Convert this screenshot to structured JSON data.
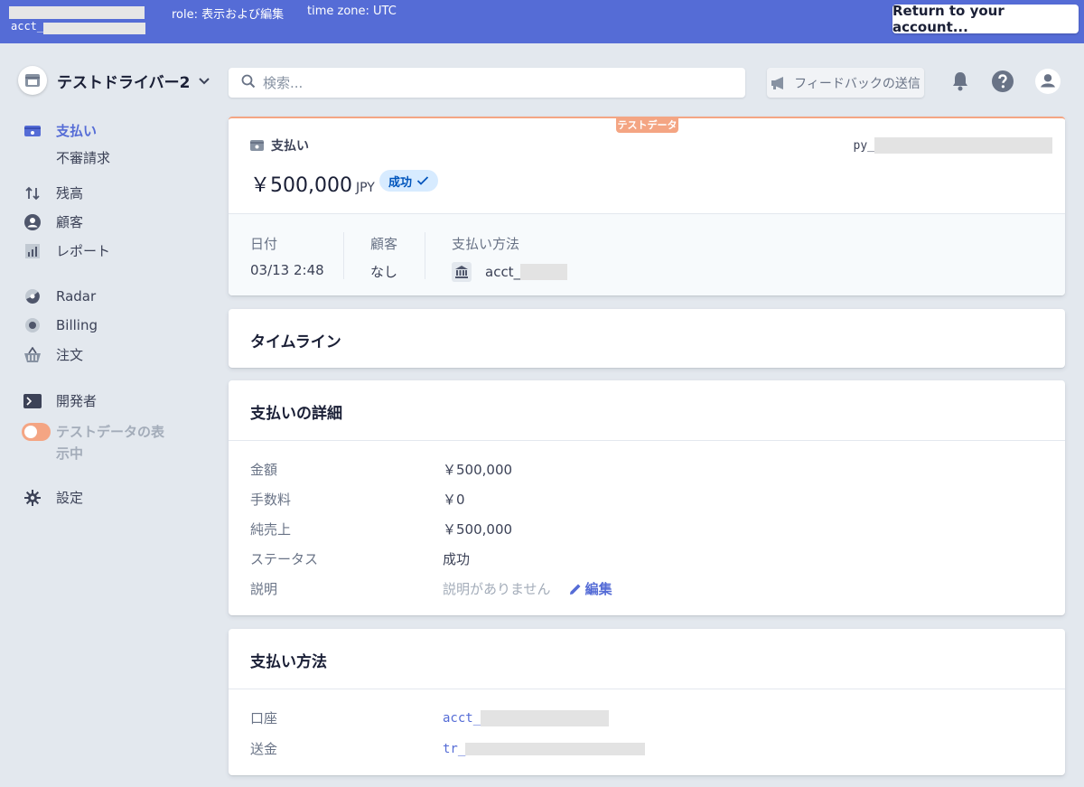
{
  "topbar": {
    "account_prefix": "acct_",
    "role": "role: 表示および編集",
    "timezone": "time zone: UTC",
    "return_label": "Return to your account..."
  },
  "sidebar": {
    "account_name": "テストドライバー2",
    "items": [
      {
        "label": "支払い",
        "icon": "payments-icon",
        "active": true
      },
      {
        "label": "不審請求",
        "sub": true
      },
      {
        "label": "残高",
        "icon": "balance-arrows-icon"
      },
      {
        "label": "顧客",
        "icon": "customer-icon"
      },
      {
        "label": "レポート",
        "icon": "report-icon"
      },
      {
        "label": "Radar",
        "icon": "radar-icon"
      },
      {
        "label": "Billing",
        "icon": "billing-icon"
      },
      {
        "label": "注文",
        "icon": "basket-icon"
      },
      {
        "label": "開発者",
        "icon": "terminal-icon"
      },
      {
        "label": "設定",
        "icon": "gear-icon"
      }
    ],
    "test_toggle_label": "テストデータの表示中"
  },
  "header": {
    "search_placeholder": "検索...",
    "feedback_label": "フィードバックの送信"
  },
  "payment": {
    "test_badge": "テストデータ",
    "section_label": "支払い",
    "id_prefix": "py_",
    "amount": "￥500,000",
    "currency": "JPY",
    "status": "成功",
    "date_label": "日付",
    "date_value": "03/13 2:48",
    "customer_label": "顧客",
    "customer_value": "なし",
    "method_label": "支払い方法",
    "method_value": "acct_"
  },
  "timeline": {
    "title": "タイムライン"
  },
  "details": {
    "title": "支払いの詳細",
    "rows": [
      {
        "key": "金額",
        "value": "￥500,000"
      },
      {
        "key": "手数料",
        "value": "￥0"
      },
      {
        "key": "純売上",
        "value": "￥500,000"
      },
      {
        "key": "ステータス",
        "value": "成功"
      },
      {
        "key": "説明",
        "value": "説明がありません"
      }
    ],
    "edit_label": "編集"
  },
  "method": {
    "title": "支払い方法",
    "rows": [
      {
        "key": "口座",
        "value": "acct_"
      },
      {
        "key": "送金",
        "value": "tr_"
      }
    ]
  },
  "colors": {
    "brand": "#556cd6",
    "test_accent": "#f4a583",
    "background": "#e3e8ee"
  }
}
